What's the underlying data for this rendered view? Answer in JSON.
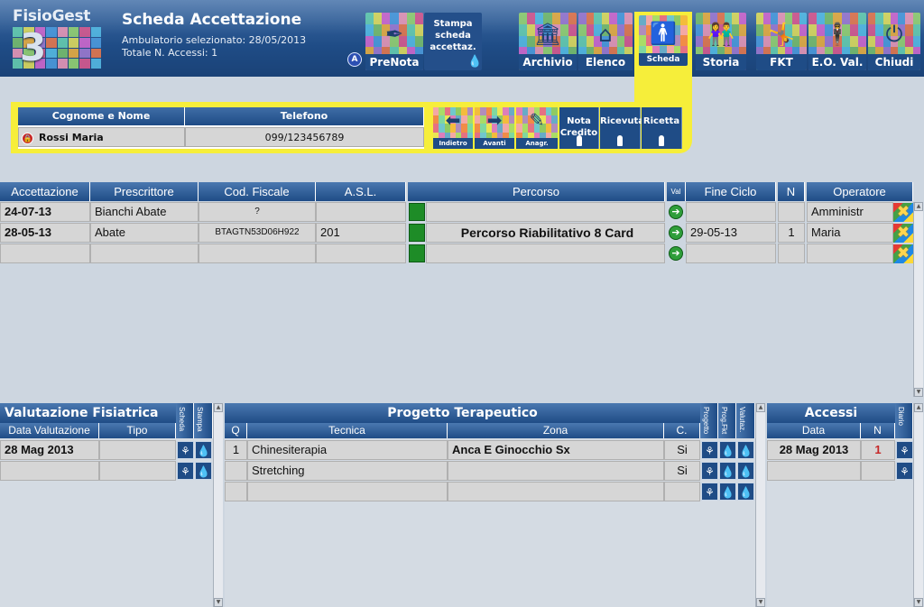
{
  "app": {
    "logo": "FisioGest",
    "logo_number": "3",
    "title": "Scheda Accettazione",
    "ambulatorio": "Ambulatorio selezionato: 28/05/2013",
    "totale": "Totale N. Accessi: 1"
  },
  "toolbar": {
    "prenota": "PreNota",
    "stampa": "Stampa scheda accettaz.",
    "archivio": "Archivio",
    "elenco": "Elenco",
    "scheda": "Scheda",
    "storia": "Storia",
    "fkt": "FKT",
    "eoval": "E.O. Val.",
    "chiudi": "Chiudi"
  },
  "colors": {
    "header_blue": "#1f4c86",
    "highlight_yellow": "#f6ee3a",
    "row_gray": "#d6d6d6",
    "status_green": "#1e8c27",
    "count_red": "#c62828"
  },
  "patient": {
    "name_header": "Cognome e Nome",
    "phone_header": "Telefono",
    "name": "Rossi Maria",
    "phone": "099/123456789"
  },
  "nav": {
    "indietro": "Indietro",
    "avanti": "Avanti",
    "anagr": "Anagr.",
    "nota_credito": "Nota Credito",
    "ricevuta": "Ricevuta",
    "ricetta": "Ricetta"
  },
  "accettazioni": {
    "headers": {
      "accettazione": "Accettazione",
      "prescrittore": "Prescrittore",
      "cod_fiscale": "Cod. Fiscale",
      "asl": "A.S.L.",
      "percorso": "Percorso",
      "val": "Val",
      "fine_ciclo": "Fine Ciclo",
      "n": "N",
      "operatore": "Operatore"
    },
    "rows": [
      {
        "accettazione": "24-07-13",
        "prescrittore": "Bianchi Abate",
        "cod_fiscale": "?",
        "asl": "",
        "percorso": "",
        "fine_ciclo": "",
        "n": "",
        "operatore": "Amministr"
      },
      {
        "accettazione": "28-05-13",
        "prescrittore": "Abate",
        "cod_fiscale": "BTAGTN53D06H922",
        "asl": "201",
        "percorso": "Percorso Riabilitativo 8 Card",
        "fine_ciclo": "29-05-13",
        "n": "1",
        "operatore": "Maria"
      },
      {
        "accettazione": "",
        "prescrittore": "",
        "cod_fiscale": "",
        "asl": "",
        "percorso": "",
        "fine_ciclo": "",
        "n": "",
        "operatore": ""
      }
    ]
  },
  "valutazione": {
    "title": "Valutazione Fisiatrica",
    "col_scheda": "Scheda",
    "col_stampa": "Stampa",
    "h_data": "Data Valutazione",
    "h_tipo": "Tipo",
    "rows": [
      {
        "data": "28 Mag 2013",
        "tipo": ""
      },
      {
        "data": "",
        "tipo": ""
      }
    ]
  },
  "progetto": {
    "title": "Progetto Terapeutico",
    "col_progetto": "Progetto",
    "col_prog_fkt": "Prog.Fkt",
    "col_valutaz": "Valutaz.",
    "h_q": "Q",
    "h_tecnica": "Tecnica",
    "h_zona": "Zona",
    "h_c": "C.",
    "rows": [
      {
        "q": "1",
        "tecnica": "Chinesiterapia",
        "zona": "Anca E Ginocchio Sx",
        "c": "Si"
      },
      {
        "q": "",
        "tecnica": "Stretching",
        "zona": "",
        "c": "Si"
      },
      {
        "q": "",
        "tecnica": "",
        "zona": "",
        "c": ""
      }
    ]
  },
  "accessi": {
    "title": "Accessi",
    "col_diario": "Diario",
    "h_data": "Data",
    "h_n": "N",
    "rows": [
      {
        "data": "28 Mag 2013",
        "n": "1"
      },
      {
        "data": "",
        "n": ""
      }
    ]
  }
}
